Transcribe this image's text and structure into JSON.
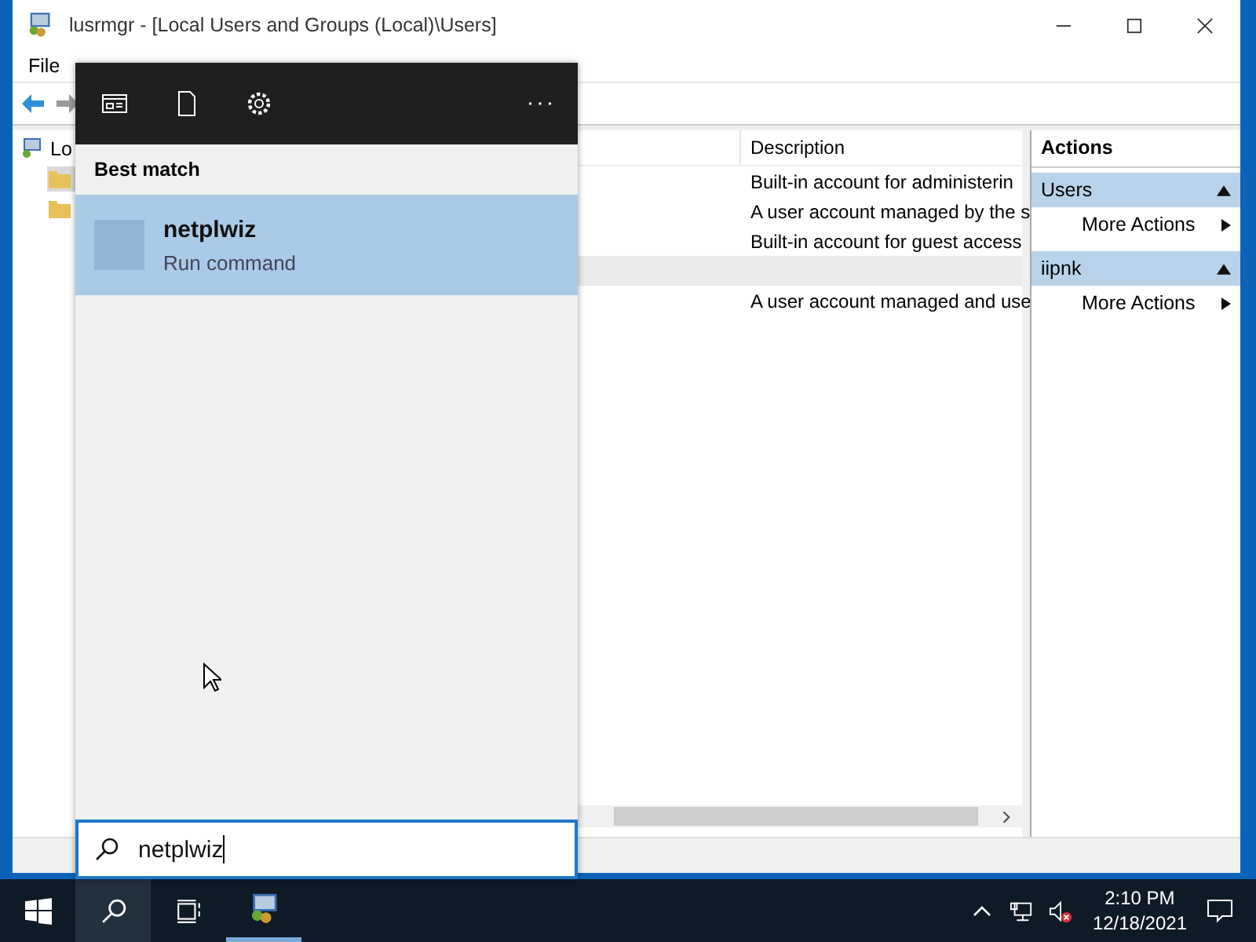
{
  "window": {
    "title": "lusrmgr - [Local Users and Groups (Local)\\Users]"
  },
  "menu": [
    {
      "label": "File"
    }
  ],
  "tree": {
    "label": "Lo",
    "children": [
      {
        "selected": true
      },
      {
        "selected": false
      }
    ]
  },
  "list": {
    "columns": [
      "Description"
    ],
    "rows": [
      {
        "description": "Built-in account for administerin",
        "selected": false
      },
      {
        "description": "A user account managed by the s",
        "selected": false
      },
      {
        "description": "Built-in account for guest access",
        "selected": false
      },
      {
        "selected": true
      },
      {
        "description": "A user account managed and use",
        "selected": false
      }
    ]
  },
  "actions": {
    "title": "Actions",
    "sections": [
      {
        "title": "Users",
        "items": [
          "More Actions"
        ]
      },
      {
        "title": "iipnk",
        "items": [
          "More Actions"
        ]
      }
    ]
  },
  "search": {
    "heading": "Best match",
    "result": {
      "name": "netplwiz",
      "subtitle": "Run command",
      "selected": true
    },
    "query": "netplwiz"
  },
  "taskbar": {
    "time": "2:10 PM",
    "date": "12/18/2021"
  }
}
